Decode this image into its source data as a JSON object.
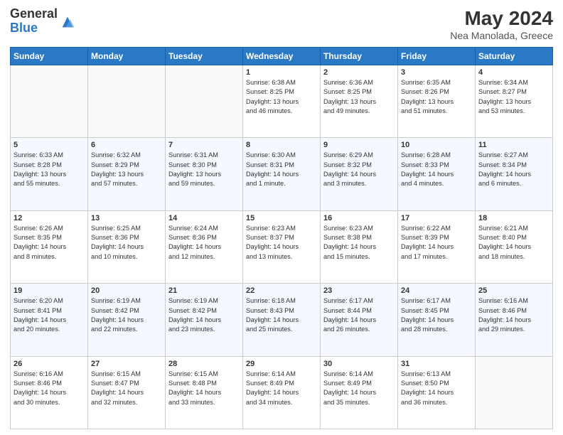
{
  "header": {
    "logo_general": "General",
    "logo_blue": "Blue",
    "month_year": "May 2024",
    "location": "Nea Manolada, Greece"
  },
  "days_of_week": [
    "Sunday",
    "Monday",
    "Tuesday",
    "Wednesday",
    "Thursday",
    "Friday",
    "Saturday"
  ],
  "weeks": [
    [
      {
        "day": "",
        "info": ""
      },
      {
        "day": "",
        "info": ""
      },
      {
        "day": "",
        "info": ""
      },
      {
        "day": "1",
        "info": "Sunrise: 6:38 AM\nSunset: 8:25 PM\nDaylight: 13 hours\nand 46 minutes."
      },
      {
        "day": "2",
        "info": "Sunrise: 6:36 AM\nSunset: 8:25 PM\nDaylight: 13 hours\nand 49 minutes."
      },
      {
        "day": "3",
        "info": "Sunrise: 6:35 AM\nSunset: 8:26 PM\nDaylight: 13 hours\nand 51 minutes."
      },
      {
        "day": "4",
        "info": "Sunrise: 6:34 AM\nSunset: 8:27 PM\nDaylight: 13 hours\nand 53 minutes."
      }
    ],
    [
      {
        "day": "5",
        "info": "Sunrise: 6:33 AM\nSunset: 8:28 PM\nDaylight: 13 hours\nand 55 minutes."
      },
      {
        "day": "6",
        "info": "Sunrise: 6:32 AM\nSunset: 8:29 PM\nDaylight: 13 hours\nand 57 minutes."
      },
      {
        "day": "7",
        "info": "Sunrise: 6:31 AM\nSunset: 8:30 PM\nDaylight: 13 hours\nand 59 minutes."
      },
      {
        "day": "8",
        "info": "Sunrise: 6:30 AM\nSunset: 8:31 PM\nDaylight: 14 hours\nand 1 minute."
      },
      {
        "day": "9",
        "info": "Sunrise: 6:29 AM\nSunset: 8:32 PM\nDaylight: 14 hours\nand 3 minutes."
      },
      {
        "day": "10",
        "info": "Sunrise: 6:28 AM\nSunset: 8:33 PM\nDaylight: 14 hours\nand 4 minutes."
      },
      {
        "day": "11",
        "info": "Sunrise: 6:27 AM\nSunset: 8:34 PM\nDaylight: 14 hours\nand 6 minutes."
      }
    ],
    [
      {
        "day": "12",
        "info": "Sunrise: 6:26 AM\nSunset: 8:35 PM\nDaylight: 14 hours\nand 8 minutes."
      },
      {
        "day": "13",
        "info": "Sunrise: 6:25 AM\nSunset: 8:36 PM\nDaylight: 14 hours\nand 10 minutes."
      },
      {
        "day": "14",
        "info": "Sunrise: 6:24 AM\nSunset: 8:36 PM\nDaylight: 14 hours\nand 12 minutes."
      },
      {
        "day": "15",
        "info": "Sunrise: 6:23 AM\nSunset: 8:37 PM\nDaylight: 14 hours\nand 13 minutes."
      },
      {
        "day": "16",
        "info": "Sunrise: 6:23 AM\nSunset: 8:38 PM\nDaylight: 14 hours\nand 15 minutes."
      },
      {
        "day": "17",
        "info": "Sunrise: 6:22 AM\nSunset: 8:39 PM\nDaylight: 14 hours\nand 17 minutes."
      },
      {
        "day": "18",
        "info": "Sunrise: 6:21 AM\nSunset: 8:40 PM\nDaylight: 14 hours\nand 18 minutes."
      }
    ],
    [
      {
        "day": "19",
        "info": "Sunrise: 6:20 AM\nSunset: 8:41 PM\nDaylight: 14 hours\nand 20 minutes."
      },
      {
        "day": "20",
        "info": "Sunrise: 6:19 AM\nSunset: 8:42 PM\nDaylight: 14 hours\nand 22 minutes."
      },
      {
        "day": "21",
        "info": "Sunrise: 6:19 AM\nSunset: 8:42 PM\nDaylight: 14 hours\nand 23 minutes."
      },
      {
        "day": "22",
        "info": "Sunrise: 6:18 AM\nSunset: 8:43 PM\nDaylight: 14 hours\nand 25 minutes."
      },
      {
        "day": "23",
        "info": "Sunrise: 6:17 AM\nSunset: 8:44 PM\nDaylight: 14 hours\nand 26 minutes."
      },
      {
        "day": "24",
        "info": "Sunrise: 6:17 AM\nSunset: 8:45 PM\nDaylight: 14 hours\nand 28 minutes."
      },
      {
        "day": "25",
        "info": "Sunrise: 6:16 AM\nSunset: 8:46 PM\nDaylight: 14 hours\nand 29 minutes."
      }
    ],
    [
      {
        "day": "26",
        "info": "Sunrise: 6:16 AM\nSunset: 8:46 PM\nDaylight: 14 hours\nand 30 minutes."
      },
      {
        "day": "27",
        "info": "Sunrise: 6:15 AM\nSunset: 8:47 PM\nDaylight: 14 hours\nand 32 minutes."
      },
      {
        "day": "28",
        "info": "Sunrise: 6:15 AM\nSunset: 8:48 PM\nDaylight: 14 hours\nand 33 minutes."
      },
      {
        "day": "29",
        "info": "Sunrise: 6:14 AM\nSunset: 8:49 PM\nDaylight: 14 hours\nand 34 minutes."
      },
      {
        "day": "30",
        "info": "Sunrise: 6:14 AM\nSunset: 8:49 PM\nDaylight: 14 hours\nand 35 minutes."
      },
      {
        "day": "31",
        "info": "Sunrise: 6:13 AM\nSunset: 8:50 PM\nDaylight: 14 hours\nand 36 minutes."
      },
      {
        "day": "",
        "info": ""
      }
    ]
  ]
}
